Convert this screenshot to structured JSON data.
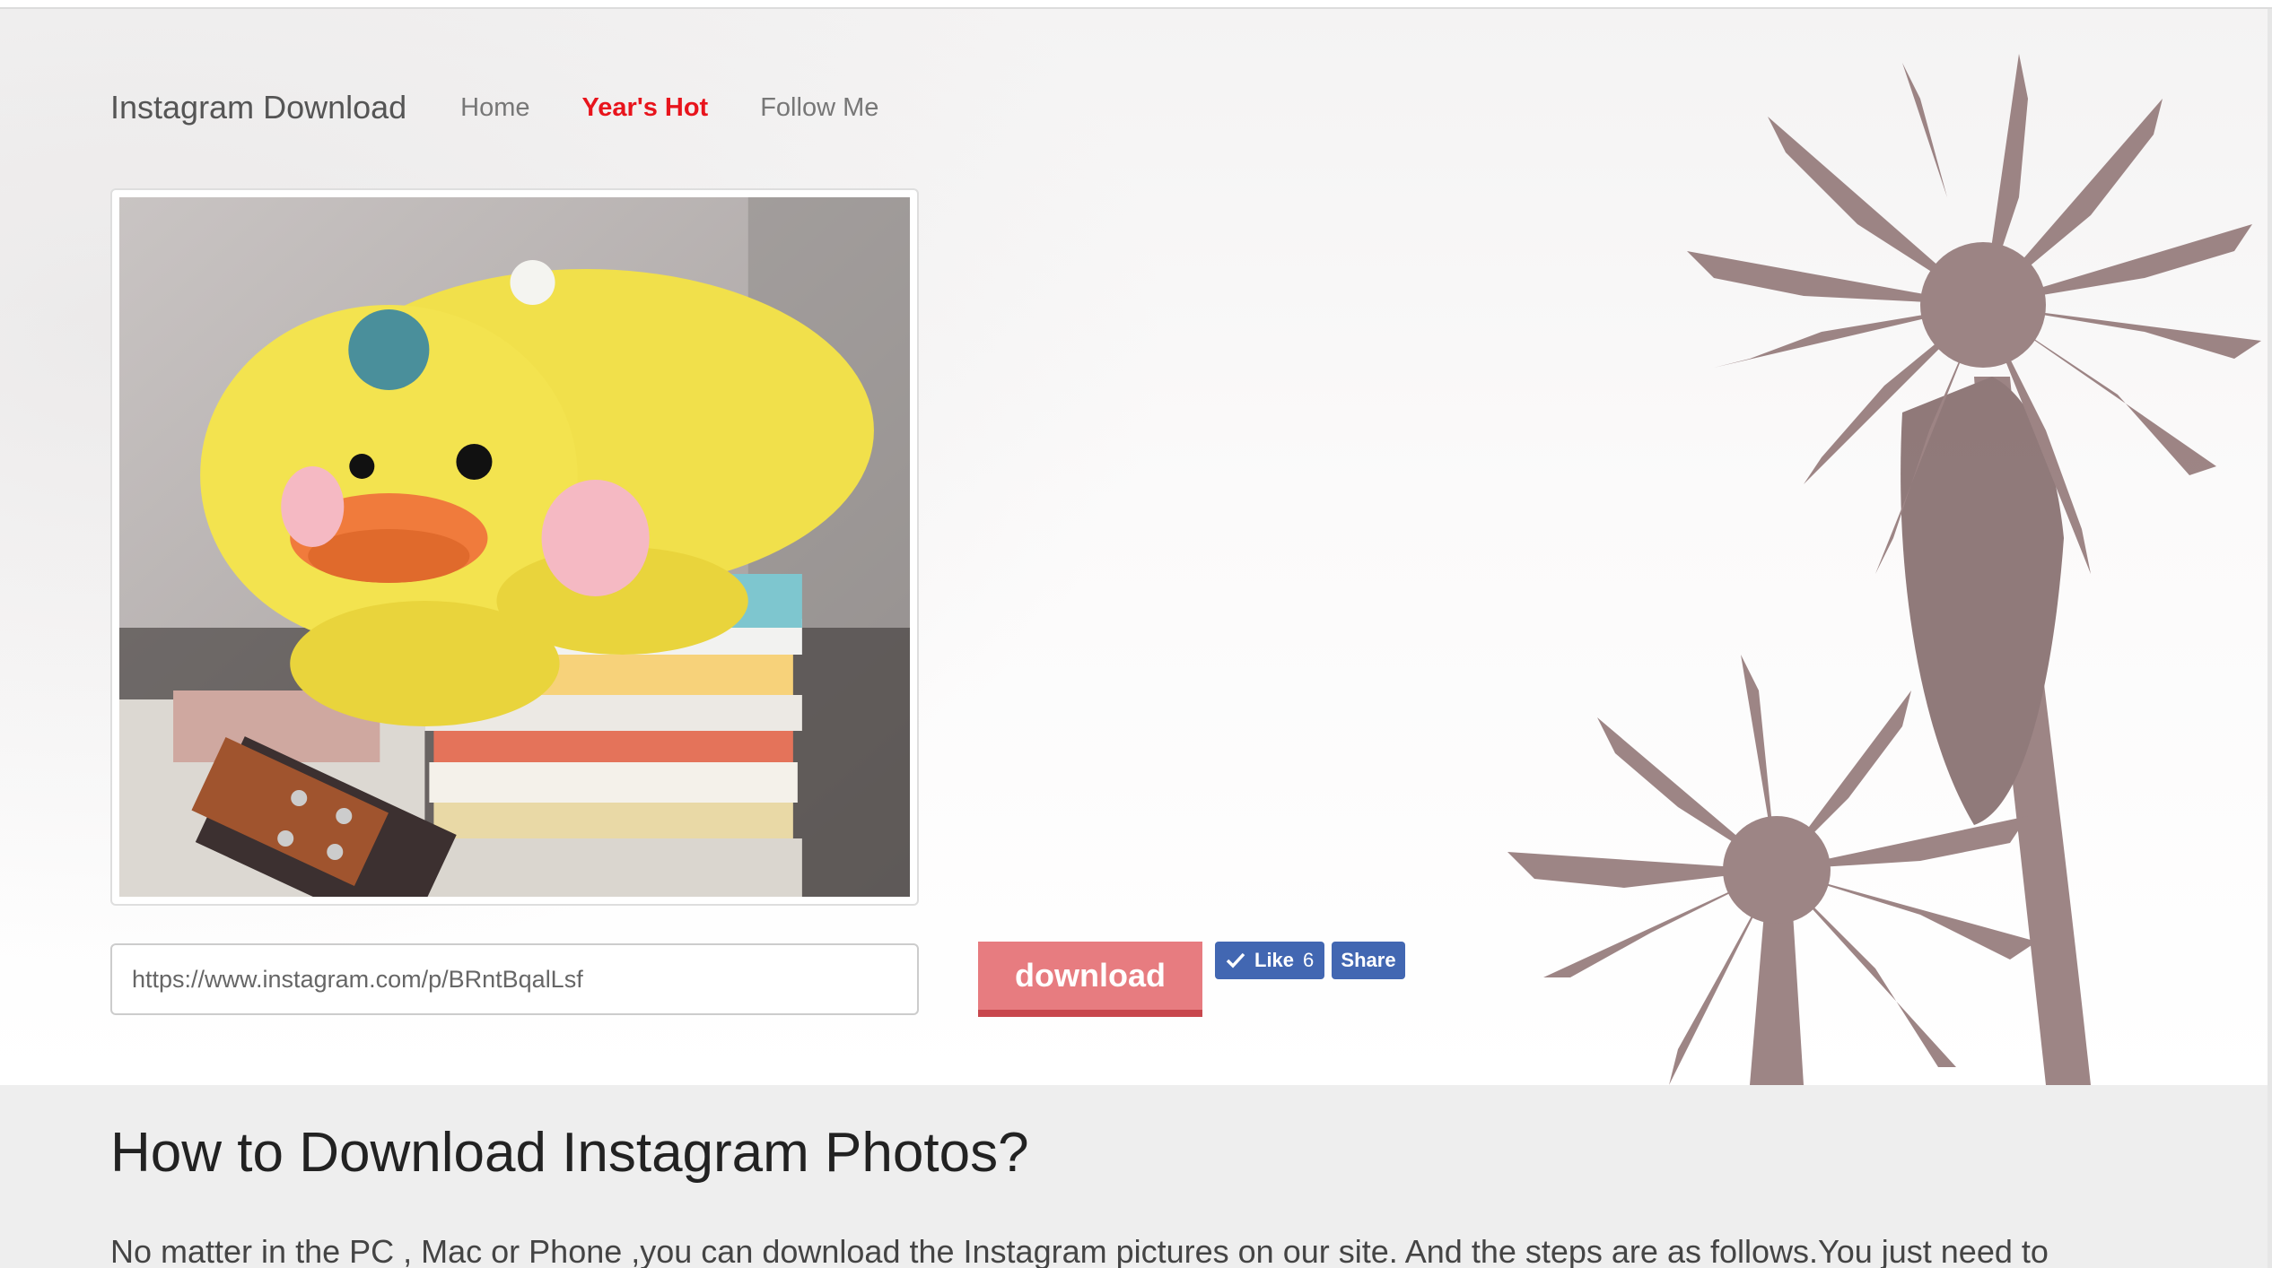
{
  "navbar": {
    "brand": "Instagram Download",
    "links": [
      {
        "label": "Home",
        "active": false
      },
      {
        "label": "Year's Hot",
        "active": true
      },
      {
        "label": "Follow Me",
        "active": false
      }
    ]
  },
  "search": {
    "value": "https://www.instagram.com/p/BRntBqalLsf"
  },
  "download_button": {
    "label": "download"
  },
  "facebook": {
    "like_label": "Like",
    "like_count": "6",
    "share_label": "Share"
  },
  "content": {
    "heading": "How to Download Instagram Photos?",
    "paragraph": "No matter in the PC , Mac or Phone ,you can download the Instagram pictures on our site. And the steps are as follows.You just need to"
  },
  "colors": {
    "active_nav": "#e8141c",
    "download_button": "#e77c80",
    "facebook_blue": "#4267b2"
  },
  "icons": {
    "like": "checkmark-icon"
  }
}
